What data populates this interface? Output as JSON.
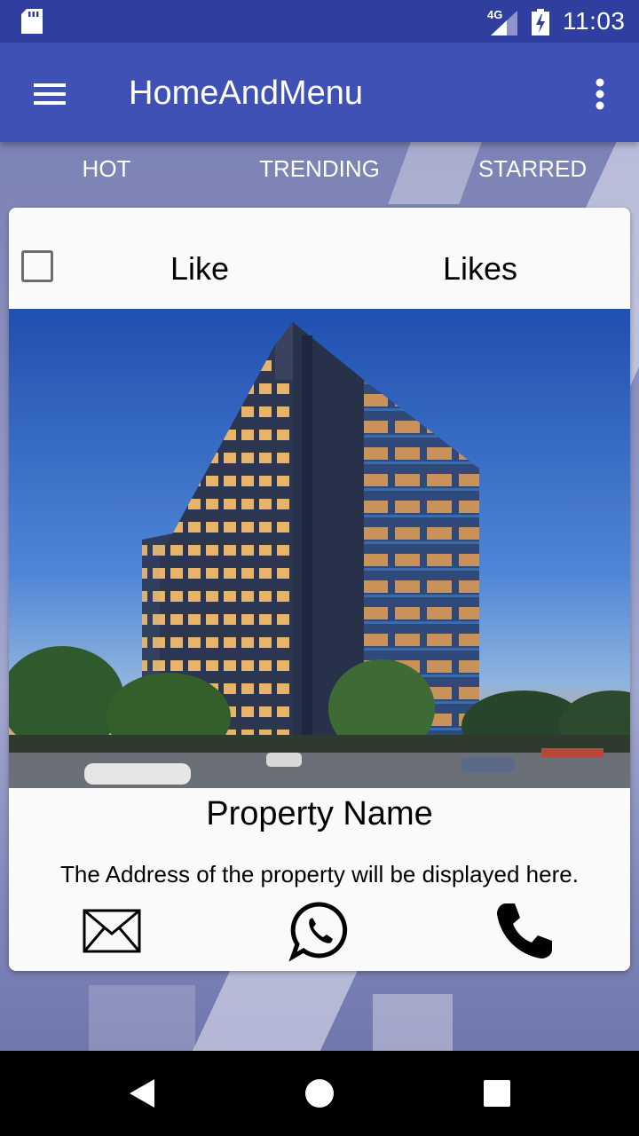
{
  "status_bar": {
    "network": "4G",
    "time": "11:03"
  },
  "app_bar": {
    "title": "HomeAndMenu"
  },
  "tabs": [
    {
      "label": "HOT"
    },
    {
      "label": "TRENDING"
    },
    {
      "label": "STARRED"
    }
  ],
  "card": {
    "like_label": "Like",
    "likes_label": "Likes",
    "property_name": "Property Name",
    "property_address": "The Address of the property will be displayed here.",
    "actions": [
      "mail-icon",
      "whatsapp-icon",
      "phone-icon"
    ]
  },
  "colors": {
    "status_bar": "#303f9f",
    "app_bar": "#3f51b5",
    "card": "#fafafa",
    "nav_bar": "#000000"
  }
}
